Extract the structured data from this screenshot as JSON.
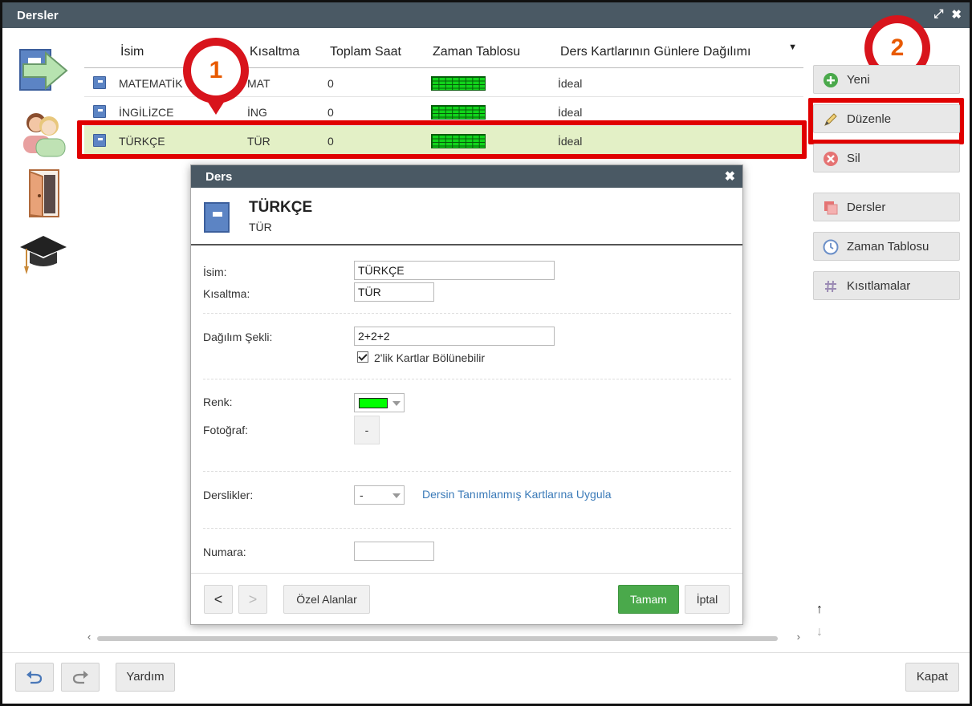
{
  "window": {
    "title": "Dersler"
  },
  "grid": {
    "columns": [
      "İsim",
      "Kısaltma",
      "Toplam Saat",
      "Zaman Tablosu",
      "Ders Kartlarının Günlere Dağılımı"
    ],
    "rows": [
      {
        "name": "MATEMATİK",
        "short": "MAT",
        "hours": "0",
        "dist": "İdeal",
        "selected": false
      },
      {
        "name": "İNGİLİZCE",
        "short": "İNG",
        "hours": "0",
        "dist": "İdeal",
        "selected": false
      },
      {
        "name": "TÜRKÇE",
        "short": "TÜR",
        "hours": "0",
        "dist": "İdeal",
        "selected": true
      }
    ],
    "timebar_color": "#11d41b"
  },
  "callouts": {
    "one": "1",
    "two": "2"
  },
  "right_buttons": {
    "new": "Yeni",
    "edit": "Düzenle",
    "delete": "Sil",
    "lessons": "Dersler",
    "timetable": "Zaman Tablosu",
    "constraints": "Kısıtlamalar"
  },
  "dialog": {
    "title": "Ders",
    "header_name": "TÜRKÇE",
    "header_short": "TÜR",
    "labels": {
      "name": "İsim:",
      "short": "Kısaltma:",
      "distribution": "Dağılım Şekli:",
      "color": "Renk:",
      "photo": "Fotoğraf:",
      "classrooms": "Derslikler:",
      "number": "Numara:"
    },
    "values": {
      "name": "TÜRKÇE",
      "short": "TÜR",
      "distribution": "2+2+2",
      "split_checkbox": "2'lik Kartlar Bölünebilir",
      "color": "#00ff00",
      "photo": "-",
      "classrooms": "-",
      "number": ""
    },
    "link": "Dersin Tanımlanmış Kartlarına Uygula",
    "footer": {
      "prev": "<",
      "next": ">",
      "custom": "Özel Alanlar",
      "ok": "Tamam",
      "cancel": "İptal"
    }
  },
  "bottom": {
    "help": "Yardım",
    "close": "Kapat"
  },
  "colors": {
    "titlebar": "#4a5964",
    "highlight": "#e00000",
    "accent_green": "#4aa94b"
  }
}
